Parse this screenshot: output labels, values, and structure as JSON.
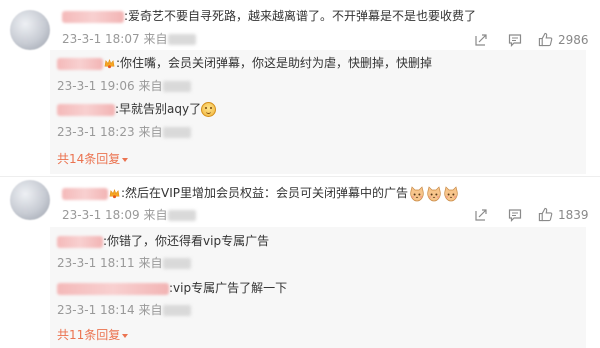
{
  "comments": [
    {
      "text": ":爱奇艺不要自寻死路，越来越离谱了。不开弹幕是不是也要收费了",
      "time": "23-3-1 18:07",
      "from": "来自",
      "likes": "2986",
      "replies": [
        {
          "text": ":你住嘴，会员关闭弹幕，你这是助纣为虐，快删掉，快删掉",
          "time": "23-3-1 19:06",
          "from": "来自"
        },
        {
          "text": ":早就告别aqy了",
          "time": "23-3-1 18:23",
          "from": "来自"
        }
      ],
      "more": "共14条回复"
    },
    {
      "text": ":然后在VIP里增加会员权益：会员可关闭弹幕中的广告",
      "time": "23-3-1 18:09",
      "from": "来自",
      "likes": "1839",
      "replies": [
        {
          "text": ":你错了，你还得看vip专属广告",
          "time": "23-3-1 18:11",
          "from": "来自"
        },
        {
          "text": ":vip专属广告了解一下",
          "time": "23-3-1 18:14",
          "from": "来自"
        }
      ],
      "more": "共11条回复"
    }
  ],
  "icons": {
    "forward": "forward-icon",
    "comment": "comment-icon",
    "like": "like-icon",
    "crown": "crown-icon",
    "emoji": "emoji-icon",
    "cat": "cat-emoji-icon"
  },
  "colors": {
    "more_link": "#eb7350",
    "meta": "#999999",
    "reply_bg": "#f7f7f7"
  }
}
